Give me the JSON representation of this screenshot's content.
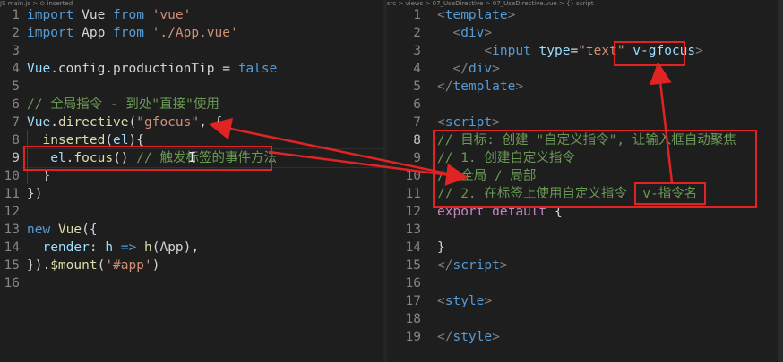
{
  "left": {
    "breadcrumb": "JS main.js > ⊙ inserted",
    "lines": [
      {
        "n": "1",
        "tokens": [
          [
            "k",
            "import"
          ],
          [
            "",
            " Vue "
          ],
          [
            "k",
            "from"
          ],
          [
            "",
            " "
          ],
          [
            "s",
            "'vue'"
          ]
        ]
      },
      {
        "n": "2",
        "tokens": [
          [
            "k",
            "import"
          ],
          [
            "",
            " App "
          ],
          [
            "k",
            "from"
          ],
          [
            "",
            " "
          ],
          [
            "s",
            "'./App.vue'"
          ]
        ]
      },
      {
        "n": "3",
        "tokens": []
      },
      {
        "n": "4",
        "tokens": [
          [
            "v",
            "Vue"
          ],
          [
            "",
            ".config.productionTip = "
          ],
          [
            "k",
            "false"
          ]
        ]
      },
      {
        "n": "5",
        "tokens": []
      },
      {
        "n": "6",
        "tokens": [
          [
            "c",
            "// 全局指令 - 到处\"直接\"使用"
          ]
        ]
      },
      {
        "n": "7",
        "tokens": [
          [
            "v",
            "Vue"
          ],
          [
            "",
            "."
          ],
          [
            "f",
            "directive"
          ],
          [
            "",
            "("
          ],
          [
            "s",
            "\"gfocus\""
          ],
          [
            "",
            ", {"
          ]
        ]
      },
      {
        "n": "8",
        "tokens": [
          [
            "",
            "  "
          ],
          [
            "f",
            "inserted"
          ],
          [
            "",
            "("
          ],
          [
            "v",
            "el"
          ],
          [
            "",
            "){"
          ]
        ]
      },
      {
        "n": "9",
        "tokens": [
          [
            "",
            "   "
          ],
          [
            "v",
            "el"
          ],
          [
            "",
            "."
          ],
          [
            "f",
            "focus"
          ],
          [
            "",
            "() "
          ],
          [
            "c",
            "// 触发标签的事件方法"
          ]
        ]
      },
      {
        "n": "10",
        "tokens": [
          [
            "",
            "  }"
          ]
        ]
      },
      {
        "n": "11",
        "tokens": [
          [
            "",
            "})"
          ]
        ]
      },
      {
        "n": "12",
        "tokens": []
      },
      {
        "n": "13",
        "tokens": [
          [
            "k",
            "new"
          ],
          [
            "",
            " "
          ],
          [
            "f",
            "Vue"
          ],
          [
            "",
            "({"
          ]
        ]
      },
      {
        "n": "14",
        "tokens": [
          [
            "",
            "  "
          ],
          [
            "v",
            "render"
          ],
          [
            "",
            ": "
          ],
          [
            "v",
            "h"
          ],
          [
            "",
            " "
          ],
          [
            "k",
            "=>"
          ],
          [
            "",
            " "
          ],
          [
            "f",
            "h"
          ],
          [
            "",
            "(App),"
          ]
        ]
      },
      {
        "n": "15",
        "tokens": [
          [
            "",
            "})."
          ],
          [
            "f",
            "$mount"
          ],
          [
            "",
            "("
          ],
          [
            "s",
            "'#app'"
          ],
          [
            "",
            ")"
          ]
        ]
      },
      {
        "n": "16",
        "tokens": []
      }
    ],
    "active_line": "9"
  },
  "right": {
    "breadcrumb": "src > views > 07_UseDirective > 07_UseDirective.vue > {} script",
    "lines": [
      {
        "n": "1",
        "tokens": [
          [
            "t",
            "<"
          ],
          [
            "tag",
            "template"
          ],
          [
            "t",
            ">"
          ]
        ]
      },
      {
        "n": "2",
        "tokens": [
          [
            "",
            "  "
          ],
          [
            "t",
            "<"
          ],
          [
            "tag",
            "div"
          ],
          [
            "t",
            ">"
          ]
        ]
      },
      {
        "n": "3",
        "tokens": [
          [
            "",
            "      "
          ],
          [
            "t",
            "<"
          ],
          [
            "tag",
            "input"
          ],
          [
            "",
            " "
          ],
          [
            "attr",
            "type"
          ],
          [
            "",
            "="
          ],
          [
            "s",
            "\"text\""
          ],
          [
            "",
            " "
          ],
          [
            "attr",
            "v-gfocus"
          ],
          [
            "t",
            ">"
          ]
        ]
      },
      {
        "n": "4",
        "tokens": [
          [
            "",
            "  "
          ],
          [
            "t",
            "</"
          ],
          [
            "tag",
            "div"
          ],
          [
            "t",
            ">"
          ]
        ]
      },
      {
        "n": "5",
        "tokens": [
          [
            "t",
            "</"
          ],
          [
            "tag",
            "template"
          ],
          [
            "t",
            ">"
          ]
        ]
      },
      {
        "n": "6",
        "tokens": []
      },
      {
        "n": "7",
        "tokens": [
          [
            "t",
            "<"
          ],
          [
            "tag",
            "script"
          ],
          [
            "t",
            ">"
          ]
        ]
      },
      {
        "n": "8",
        "tokens": [
          [
            "c",
            "// 目标: 创建 \"自定义指令\", 让输入框自动聚焦"
          ]
        ]
      },
      {
        "n": "9",
        "tokens": [
          [
            "c",
            "// 1. 创建自定义指令"
          ]
        ]
      },
      {
        "n": "10",
        "tokens": [
          [
            "c",
            "// 全局 / 局部"
          ]
        ]
      },
      {
        "n": "11",
        "tokens": [
          [
            "c",
            "// 2. 在标签上使用自定义指令  v-指令名"
          ]
        ]
      },
      {
        "n": "12",
        "tokens": [
          [
            "kw",
            "export"
          ],
          [
            "",
            " "
          ],
          [
            "kw",
            "default"
          ],
          [
            "",
            " {"
          ]
        ]
      },
      {
        "n": "13",
        "tokens": []
      },
      {
        "n": "14",
        "tokens": [
          [
            "",
            "}"
          ]
        ]
      },
      {
        "n": "15",
        "tokens": [
          [
            "t",
            "</"
          ],
          [
            "tag",
            "script"
          ],
          [
            "t",
            ">"
          ]
        ]
      },
      {
        "n": "16",
        "tokens": []
      },
      {
        "n": "17",
        "tokens": [
          [
            "t",
            "<"
          ],
          [
            "tag",
            "style"
          ],
          [
            "t",
            ">"
          ]
        ]
      },
      {
        "n": "18",
        "tokens": []
      },
      {
        "n": "19",
        "tokens": [
          [
            "t",
            "</"
          ],
          [
            "tag",
            "style"
          ],
          [
            "t",
            ">"
          ]
        ]
      }
    ],
    "active_line": "8"
  },
  "colors": {
    "annotation": "#e02424",
    "background": "#1e1e1e"
  }
}
